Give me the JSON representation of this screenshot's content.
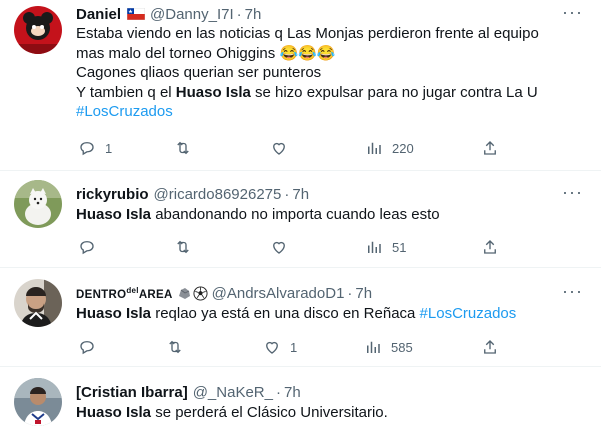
{
  "tweets": [
    {
      "name": "Daniel",
      "handle": "@Danny_I7I",
      "time": "7h",
      "badge_flag": "chile-flag",
      "lines": [
        {
          "text": "Estaba viendo en las noticias q Las Monjas perdieron frente al equipo"
        },
        {
          "text": "mas malo del torneo Ohiggins "
        },
        {
          "text": "Cagones qliaos querian ser punteros"
        },
        {
          "pre": "Y tambien q el ",
          "bold": "Huaso Isla",
          "post": " se hizo expulsar para no jugar contra La U"
        },
        {
          "hashtag": "#LosCruzados"
        }
      ],
      "emoji": "😂😂😂",
      "replies": "1",
      "retweets": "",
      "likes": "",
      "views": "220"
    },
    {
      "name": "rickyrubio",
      "handle": "@ricardo86926275",
      "time": "7h",
      "bold": "Huaso Isla",
      "text": " abandonando no importa cuando leas esto",
      "replies": "",
      "retweets": "",
      "likes": "",
      "views": "51"
    },
    {
      "name_prefix": "DENTRO",
      "name_sup": "del",
      "name_suffix": "AREA",
      "handle": "@AndrsAlvaradoD1",
      "time": "7h",
      "bold": "Huaso Isla",
      "text": " reqlao ya está en una disco en Reñaca ",
      "hashtag": "#LosCruzados",
      "replies": "",
      "retweets": "",
      "likes": "1",
      "views": "585"
    },
    {
      "name": "[Cristian Ibarra]",
      "handle": "@_NaKeR_",
      "time": "7h",
      "bold": "Huaso Isla",
      "text": " se perderá el Clásico Universitario."
    }
  ],
  "separator": "·",
  "colors": {
    "accent": "#1d9bf0",
    "muted": "#536471",
    "text": "#0f1419"
  }
}
